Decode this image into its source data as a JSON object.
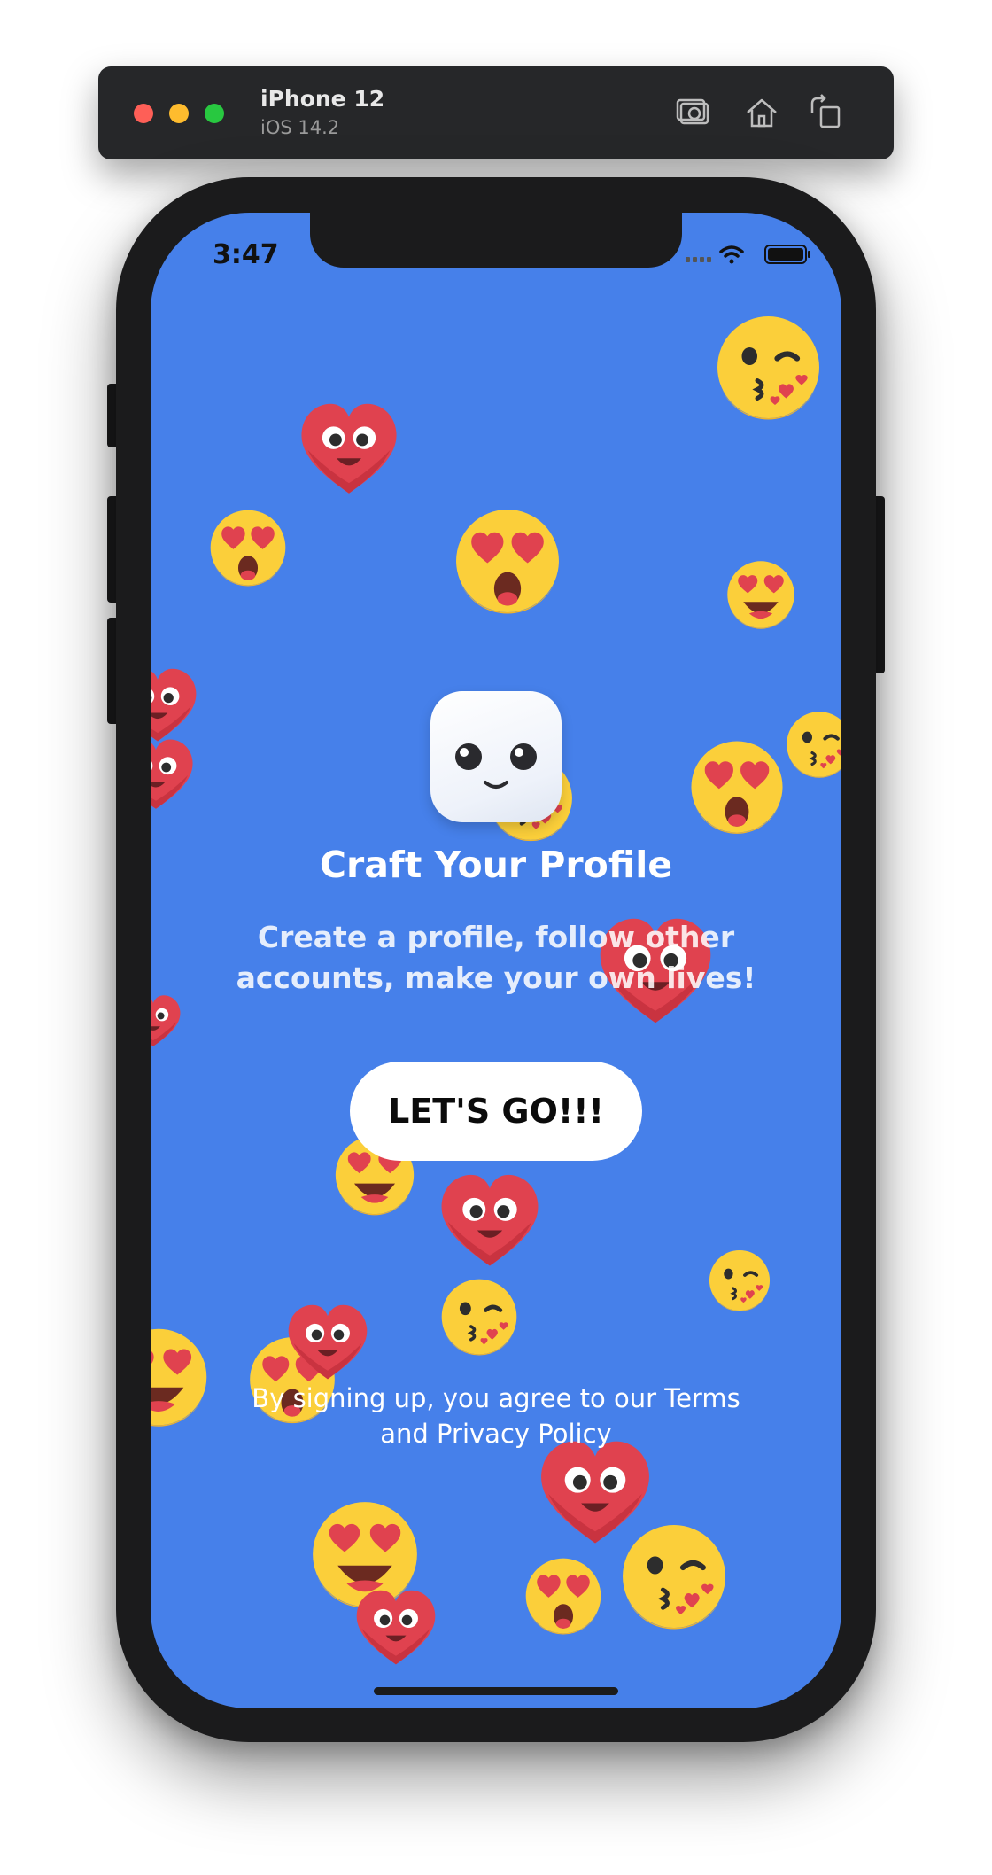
{
  "simulator": {
    "device_name": "iPhone 12",
    "os_version": "iOS 14.2",
    "toolbar_icons": [
      "screenshot-icon",
      "home-icon",
      "rotate-icon"
    ]
  },
  "status_bar": {
    "time": "3:47",
    "icons": [
      "signal-icon",
      "wifi-icon",
      "battery-icon"
    ]
  },
  "onboarding": {
    "title": "Craft Your Profile",
    "subtitle": "Create a profile, follow other accounts, make your own lives!",
    "cta_label": "LET'S GO!!!",
    "legal_text": "By signing up, you agree to our Terms and Privacy Policy"
  },
  "colors": {
    "background": "#4680ea",
    "heart": "#e0424f",
    "emoji_face": "#fbcf3a",
    "button": "#ffffff"
  },
  "background_emojis": [
    "heart-eyes-heart",
    "heart-eyes-face",
    "kiss-wink-face",
    "smiling-heart-eyes-face"
  ]
}
